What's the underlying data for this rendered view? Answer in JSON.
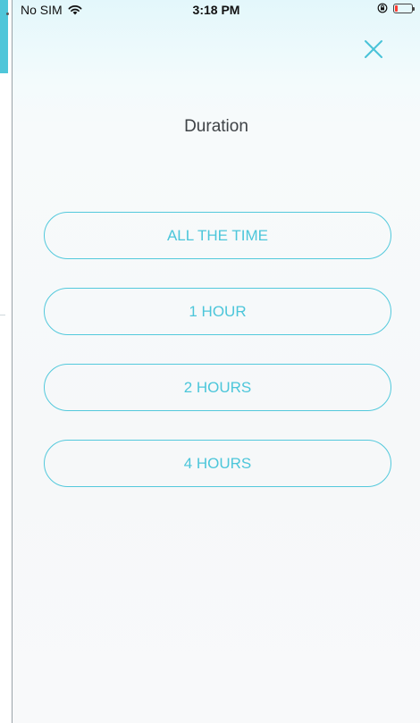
{
  "status_bar": {
    "carrier": "No SIM",
    "time": "3:18 PM",
    "icons": [
      "wifi-icon",
      "rotation-lock-icon",
      "battery-icon"
    ],
    "battery_color": "#ff3b30"
  },
  "modal": {
    "title": "Duration",
    "close_icon": "close-icon",
    "options": [
      {
        "label": "ALL THE TIME"
      },
      {
        "label": "1 HOUR"
      },
      {
        "label": "2 HOURS"
      },
      {
        "label": "4 HOURS"
      }
    ]
  },
  "colors": {
    "accent": "#4cc6da",
    "title": "#3e4246",
    "background_top": "#e3f7fb"
  }
}
